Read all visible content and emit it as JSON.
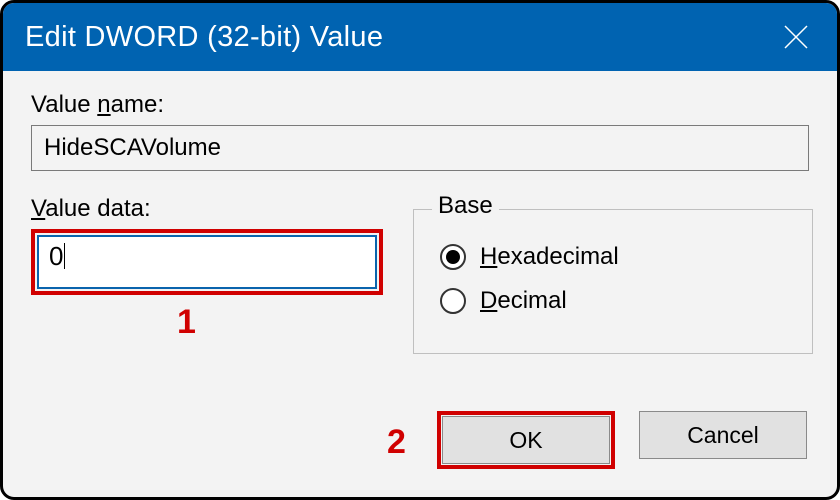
{
  "title": "Edit DWORD (32-bit) Value",
  "labels": {
    "value_name_pre": "Value ",
    "value_name_u": "n",
    "value_name_post": "ame:",
    "value_data_u": "V",
    "value_data_post": "alue data:",
    "base_legend": "Base",
    "hex_u": "H",
    "hex_post": "exadecimal",
    "dec_u": "D",
    "dec_post": "ecimal"
  },
  "fields": {
    "value_name": "HideSCAVolume",
    "value_data": "0"
  },
  "base_selected": "hex",
  "buttons": {
    "ok": "OK",
    "cancel": "Cancel"
  },
  "annotations": {
    "a1": "1",
    "a2": "2"
  }
}
